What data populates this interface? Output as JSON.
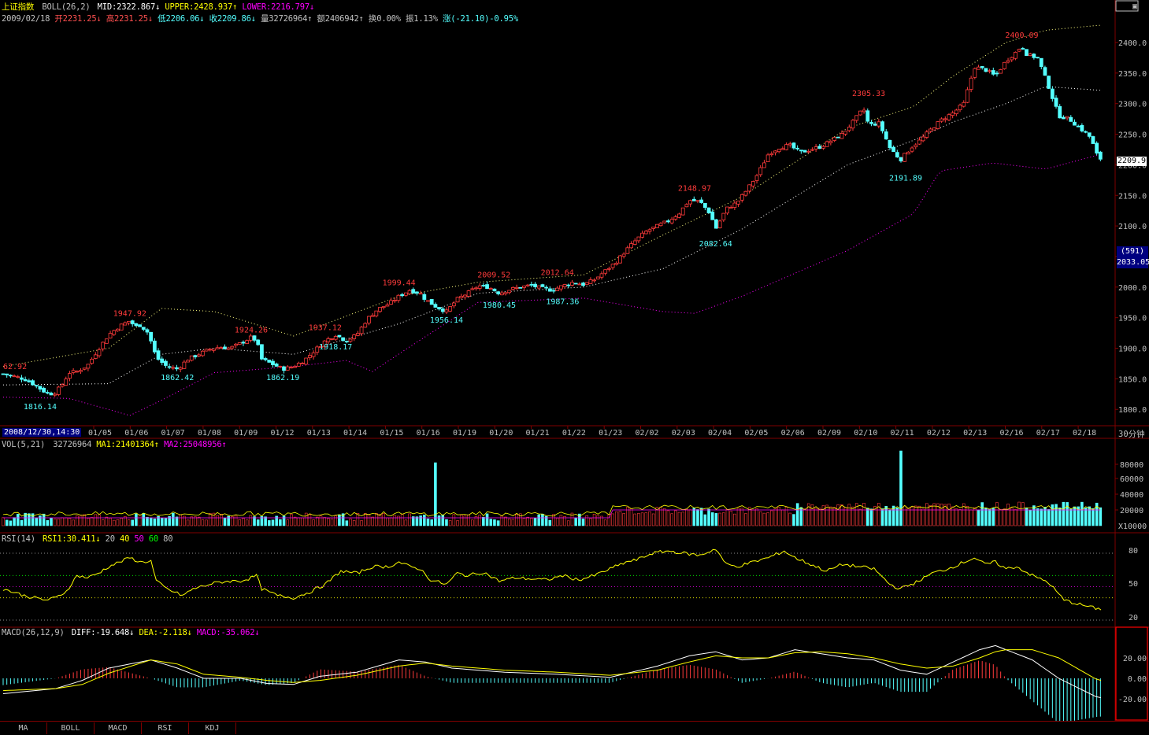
{
  "header": {
    "index_name": "上证指数",
    "boll": {
      "label": "BOLL(26,2)",
      "mid": "MID:2322.867↓",
      "upper": "UPPER:2428.937↑",
      "lower": "LOWER:2216.797↓"
    },
    "quote": {
      "date": "2009/02/18",
      "open": "开2231.25↓",
      "high": "高2231.25↓",
      "low": "低2206.06↓",
      "close": "收2209.86↓",
      "vol": "量32726964↑",
      "amount": "额2406942↑",
      "turnover": "换0.00%",
      "amplitude": "振1.13%",
      "change": "涨(-21.10)-0.95%"
    }
  },
  "price_labels": {
    "current": "2209.9",
    "cursor_count": "(591)",
    "cursor_value": "2033.05",
    "period": "30分钟",
    "axis_start": "2008/12/30,14:30"
  },
  "annotations": [
    "62.92",
    "1816.14",
    "1947.92",
    "1862.42",
    "1924.26",
    "1862.19",
    "1937.12",
    "1918.17",
    "1999.44",
    "1956.14",
    "2009.52",
    "1980.45",
    "2012.64",
    "1987.36",
    "2148.97",
    "2082.64",
    "2305.33",
    "2191.89",
    "2400.09"
  ],
  "date_labels": [
    "01/05",
    "01/06",
    "01/07",
    "01/08",
    "01/09",
    "01/12",
    "01/13",
    "01/14",
    "01/15",
    "01/16",
    "01/19",
    "01/20",
    "01/21",
    "01/22",
    "01/23",
    "02/02",
    "02/03",
    "02/04",
    "02/05",
    "02/06",
    "02/09",
    "02/10",
    "02/11",
    "02/12",
    "02/13",
    "02/16",
    "02/17",
    "02/18"
  ],
  "vol_panel": {
    "label": "VOL(5,21)",
    "value": "32726964",
    "ma1": "MA1:21401364↑",
    "ma2": "MA2:25048956↑",
    "unit": "X10000",
    "ticks": [
      "80000",
      "60000",
      "40000",
      "20000"
    ]
  },
  "rsi_panel": {
    "label": "RSI(14)",
    "rsi1": "RSI1:30.411↓",
    "levels": [
      "20",
      "40",
      "50",
      "60",
      "80"
    ],
    "ticks": [
      "80",
      "50",
      "20"
    ]
  },
  "macd_panel": {
    "label": "MACD(26,12,9)",
    "diff": "DIFF:-19.648↓",
    "dea": "DEA:-2.118↓",
    "macd": "MACD:-35.062↓",
    "ticks": [
      "20.00",
      "0.00",
      "-20.00"
    ]
  },
  "tabs": [
    "MA",
    "BOLL",
    "MACD",
    "RSI",
    "KDJ"
  ],
  "colors": {
    "up": "#ff3b3b",
    "down": "#54ffff",
    "ma1": "#ffff00",
    "ma2": "#ff00ff",
    "frame": "#800000",
    "text": "#c0c0c0"
  },
  "chart_data": {
    "type": "candlestick",
    "y_axis_ticks": [
      2400,
      2350,
      2300,
      2250,
      2200,
      2150,
      2100,
      2050,
      2000,
      1950,
      1900,
      1850,
      1800
    ],
    "ylim": [
      1780,
      2440
    ],
    "close_path": [
      [
        0,
        1858
      ],
      [
        8,
        1850
      ],
      [
        12,
        1840
      ],
      [
        16,
        1828
      ],
      [
        19,
        1825
      ],
      [
        22,
        1838
      ],
      [
        25,
        1860
      ],
      [
        28,
        1862
      ],
      [
        32,
        1872
      ],
      [
        36,
        1898
      ],
      [
        40,
        1922
      ],
      [
        44,
        1936
      ],
      [
        48,
        1945
      ],
      [
        50,
        1935
      ],
      [
        52,
        1938
      ],
      [
        55,
        1925
      ],
      [
        58,
        1885
      ],
      [
        62,
        1870
      ],
      [
        66,
        1866
      ],
      [
        70,
        1882
      ],
      [
        74,
        1890
      ],
      [
        78,
        1898
      ],
      [
        82,
        1902
      ],
      [
        86,
        1900
      ],
      [
        90,
        1908
      ],
      [
        94,
        1918
      ],
      [
        96,
        1912
      ],
      [
        98,
        1882
      ],
      [
        102,
        1874
      ],
      [
        106,
        1866
      ],
      [
        110,
        1870
      ],
      [
        114,
        1880
      ],
      [
        118,
        1896
      ],
      [
        122,
        1912
      ],
      [
        126,
        1922
      ],
      [
        130,
        1912
      ],
      [
        134,
        1922
      ],
      [
        138,
        1948
      ],
      [
        142,
        1964
      ],
      [
        146,
        1972
      ],
      [
        150,
        1985
      ],
      [
        154,
        1995
      ],
      [
        158,
        1990
      ],
      [
        160,
        1980
      ],
      [
        164,
        1968
      ],
      [
        168,
        1960
      ],
      [
        172,
        1980
      ],
      [
        176,
        1990
      ],
      [
        180,
        2002
      ],
      [
        184,
        2000
      ],
      [
        188,
        1990
      ],
      [
        192,
        1996
      ],
      [
        196,
        2000
      ],
      [
        200,
        2003
      ],
      [
        204,
        1998
      ],
      [
        208,
        1995
      ],
      [
        212,
        2002
      ],
      [
        216,
        2008
      ],
      [
        220,
        2004
      ],
      [
        224,
        2012
      ],
      [
        228,
        2026
      ],
      [
        232,
        2040
      ],
      [
        236,
        2060
      ],
      [
        240,
        2078
      ],
      [
        244,
        2092
      ],
      [
        248,
        2100
      ],
      [
        252,
        2108
      ],
      [
        256,
        2120
      ],
      [
        260,
        2142
      ],
      [
        264,
        2140
      ],
      [
        268,
        2120
      ],
      [
        270,
        2095
      ],
      [
        274,
        2128
      ],
      [
        278,
        2138
      ],
      [
        282,
        2160
      ],
      [
        286,
        2185
      ],
      [
        290,
        2218
      ],
      [
        294,
        2228
      ],
      [
        298,
        2232
      ],
      [
        302,
        2220
      ],
      [
        306,
        2225
      ],
      [
        310,
        2230
      ],
      [
        314,
        2240
      ],
      [
        318,
        2250
      ],
      [
        322,
        2270
      ],
      [
        326,
        2292
      ],
      [
        328,
        2265
      ],
      [
        332,
        2268
      ],
      [
        336,
        2228
      ],
      [
        340,
        2208
      ],
      [
        344,
        2228
      ],
      [
        348,
        2242
      ],
      [
        352,
        2260
      ],
      [
        356,
        2275
      ],
      [
        360,
        2285
      ],
      [
        364,
        2300
      ],
      [
        368,
        2360
      ],
      [
        372,
        2356
      ],
      [
        376,
        2345
      ],
      [
        380,
        2370
      ],
      [
        384,
        2385
      ],
      [
        386,
        2395
      ],
      [
        388,
        2380
      ],
      [
        392,
        2375
      ],
      [
        396,
        2330
      ],
      [
        400,
        2280
      ],
      [
        404,
        2275
      ],
      [
        408,
        2260
      ],
      [
        412,
        2245
      ],
      [
        415,
        2210
      ]
    ],
    "boll_upper": [
      [
        0,
        1870
      ],
      [
        40,
        1900
      ],
      [
        60,
        1965
      ],
      [
        80,
        1960
      ],
      [
        110,
        1920
      ],
      [
        150,
        1985
      ],
      [
        180,
        2008
      ],
      [
        220,
        2020
      ],
      [
        250,
        2085
      ],
      [
        280,
        2148
      ],
      [
        320,
        2260
      ],
      [
        345,
        2295
      ],
      [
        360,
        2345
      ],
      [
        380,
        2400
      ],
      [
        395,
        2420
      ],
      [
        415,
        2428
      ]
    ],
    "boll_mid": [
      [
        0,
        1840
      ],
      [
        40,
        1842
      ],
      [
        60,
        1890
      ],
      [
        80,
        1900
      ],
      [
        110,
        1890
      ],
      [
        150,
        1940
      ],
      [
        180,
        1990
      ],
      [
        220,
        2000
      ],
      [
        250,
        2030
      ],
      [
        280,
        2095
      ],
      [
        320,
        2200
      ],
      [
        345,
        2240
      ],
      [
        360,
        2270
      ],
      [
        380,
        2300
      ],
      [
        395,
        2328
      ],
      [
        415,
        2322
      ]
    ],
    "boll_lower": [
      [
        0,
        1820
      ],
      [
        25,
        1818
      ],
      [
        48,
        1790
      ],
      [
        60,
        1815
      ],
      [
        80,
        1860
      ],
      [
        110,
        1870
      ],
      [
        130,
        1880
      ],
      [
        140,
        1862
      ],
      [
        155,
        1905
      ],
      [
        180,
        1975
      ],
      [
        220,
        1982
      ],
      [
        250,
        1960
      ],
      [
        262,
        1957
      ],
      [
        280,
        1985
      ],
      [
        320,
        2060
      ],
      [
        345,
        2120
      ],
      [
        355,
        2190
      ],
      [
        375,
        2203
      ],
      [
        395,
        2193
      ],
      [
        415,
        2216
      ]
    ],
    "series": [
      {
        "name": "RSI1",
        "values_path": [
          [
            0,
            48
          ],
          [
            8,
            42
          ],
          [
            16,
            38
          ],
          [
            20,
            40
          ],
          [
            24,
            46
          ],
          [
            28,
            60
          ],
          [
            32,
            58
          ],
          [
            36,
            62
          ],
          [
            40,
            68
          ],
          [
            44,
            72
          ],
          [
            48,
            76
          ],
          [
            52,
            72
          ],
          [
            56,
            73
          ],
          [
            58,
            55
          ],
          [
            62,
            48
          ],
          [
            68,
            42
          ],
          [
            72,
            48
          ],
          [
            78,
            52
          ],
          [
            82,
            54
          ],
          [
            86,
            55
          ],
          [
            90,
            55
          ],
          [
            94,
            58
          ],
          [
            96,
            60
          ],
          [
            98,
            48
          ],
          [
            104,
            42
          ],
          [
            110,
            40
          ],
          [
            116,
            45
          ],
          [
            122,
            52
          ],
          [
            128,
            64
          ],
          [
            134,
            62
          ],
          [
            140,
            68
          ],
          [
            146,
            68
          ],
          [
            150,
            72
          ],
          [
            154,
            68
          ],
          [
            158,
            66
          ],
          [
            162,
            56
          ],
          [
            168,
            52
          ],
          [
            172,
            62
          ],
          [
            176,
            60
          ],
          [
            182,
            63
          ],
          [
            188,
            55
          ],
          [
            194,
            58
          ],
          [
            200,
            57
          ],
          [
            206,
            56
          ],
          [
            212,
            60
          ],
          [
            218,
            56
          ],
          [
            224,
            60
          ],
          [
            230,
            66
          ],
          [
            236,
            72
          ],
          [
            240,
            74
          ],
          [
            246,
            80
          ],
          [
            252,
            82
          ],
          [
            258,
            80
          ],
          [
            264,
            78
          ],
          [
            270,
            84
          ],
          [
            274,
            70
          ],
          [
            278,
            68
          ],
          [
            284,
            72
          ],
          [
            290,
            76
          ],
          [
            296,
            82
          ],
          [
            300,
            76
          ],
          [
            306,
            70
          ],
          [
            312,
            64
          ],
          [
            318,
            70
          ],
          [
            324,
            68
          ],
          [
            330,
            66
          ],
          [
            336,
            52
          ],
          [
            340,
            48
          ],
          [
            346,
            54
          ],
          [
            352,
            62
          ],
          [
            358,
            66
          ],
          [
            364,
            72
          ],
          [
            368,
            76
          ],
          [
            372,
            70
          ],
          [
            376,
            72
          ],
          [
            380,
            66
          ],
          [
            384,
            68
          ],
          [
            390,
            60
          ],
          [
            396,
            54
          ],
          [
            402,
            38
          ],
          [
            408,
            34
          ],
          [
            415,
            30
          ]
        ]
      },
      {
        "name": "DIFF",
        "values_path": [
          [
            0,
            -15
          ],
          [
            20,
            -10
          ],
          [
            30,
            -2
          ],
          [
            40,
            10
          ],
          [
            56,
            18
          ],
          [
            66,
            10
          ],
          [
            76,
            0
          ],
          [
            90,
            0
          ],
          [
            100,
            -5
          ],
          [
            110,
            -6
          ],
          [
            120,
            2
          ],
          [
            134,
            6
          ],
          [
            150,
            18
          ],
          [
            160,
            16
          ],
          [
            170,
            10
          ],
          [
            190,
            6
          ],
          [
            210,
            4
          ],
          [
            230,
            1
          ],
          [
            248,
            12
          ],
          [
            260,
            22
          ],
          [
            270,
            26
          ],
          [
            280,
            18
          ],
          [
            290,
            20
          ],
          [
            300,
            28
          ],
          [
            310,
            24
          ],
          [
            320,
            20
          ],
          [
            330,
            18
          ],
          [
            340,
            8
          ],
          [
            350,
            4
          ],
          [
            360,
            16
          ],
          [
            370,
            28
          ],
          [
            376,
            32
          ],
          [
            380,
            28
          ],
          [
            390,
            18
          ],
          [
            400,
            0
          ],
          [
            415,
            -19
          ]
        ]
      },
      {
        "name": "DEA",
        "values_path": [
          [
            0,
            -12
          ],
          [
            20,
            -10
          ],
          [
            30,
            -6
          ],
          [
            40,
            5
          ],
          [
            56,
            18
          ],
          [
            66,
            14
          ],
          [
            76,
            4
          ],
          [
            90,
            1
          ],
          [
            100,
            -2
          ],
          [
            110,
            -4
          ],
          [
            120,
            -2
          ],
          [
            134,
            3
          ],
          [
            150,
            12
          ],
          [
            160,
            15
          ],
          [
            170,
            12
          ],
          [
            190,
            8
          ],
          [
            210,
            6
          ],
          [
            230,
            3
          ],
          [
            248,
            8
          ],
          [
            260,
            16
          ],
          [
            270,
            22
          ],
          [
            280,
            20
          ],
          [
            290,
            20
          ],
          [
            300,
            25
          ],
          [
            310,
            26
          ],
          [
            320,
            24
          ],
          [
            330,
            20
          ],
          [
            340,
            14
          ],
          [
            350,
            10
          ],
          [
            360,
            12
          ],
          [
            370,
            20
          ],
          [
            376,
            26
          ],
          [
            380,
            28
          ],
          [
            390,
            28
          ],
          [
            400,
            20
          ],
          [
            415,
            -2
          ]
        ]
      }
    ]
  }
}
